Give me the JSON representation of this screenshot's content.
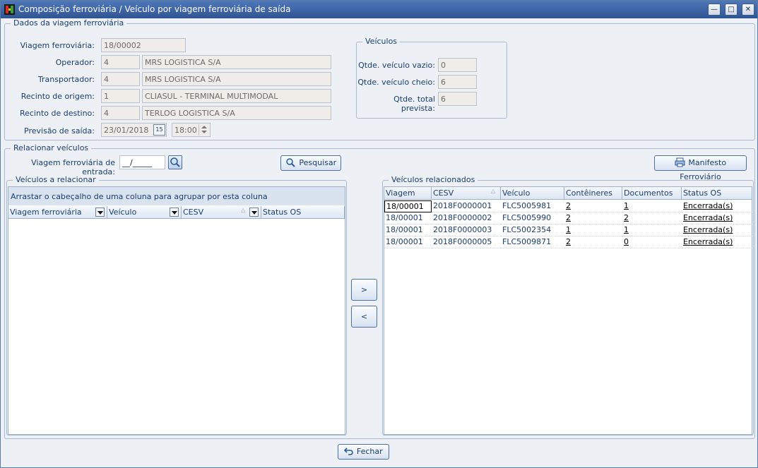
{
  "window": {
    "title": "Composição ferroviária / Veículo por viagem ferroviária de saída"
  },
  "dados": {
    "legend": "Dados da viagem ferroviária",
    "viagem_label": "Viagem ferroviária:",
    "viagem_value": "18/00002",
    "operador_label": "Operador:",
    "operador_code": "4",
    "operador_name": "MRS LOGISTICA S/A",
    "transportador_label": "Transportador:",
    "transportador_code": "4",
    "transportador_name": "MRS LOGISTICA S/A",
    "origem_label": "Recinto de origem:",
    "origem_code": "1",
    "origem_name": "CLIASUL - TERMINAL MULTIMODAL",
    "destino_label": "Recinto de destino:",
    "destino_code": "4",
    "destino_name": "TERLOG LOGISTICA S/A",
    "previsao_label": "Previsão de saída:",
    "previsao_date": "23/01/2018",
    "previsao_time": "18:00",
    "calendar_label": "15"
  },
  "veiculos": {
    "legend": "Veículos",
    "vazio_label": "Qtde. veículo vazio:",
    "vazio_value": "0",
    "cheio_label": "Qtde. veículo cheio:",
    "cheio_value": "6",
    "total_label": "Qtde. total prevista:",
    "total_value": "6"
  },
  "relacionar": {
    "legend": "Relacionar veículos",
    "entrada_label": "Viagem ferroviária de entrada:",
    "entrada_value": "__/_____",
    "pesquisar_label": "Pesquisar",
    "manifesto_label": "Manifesto Ferroviário"
  },
  "left_grid": {
    "legend": "Veículos a relacionar",
    "group_hint": "Arrastar o cabeçalho de uma coluna para agrupar por esta coluna",
    "columns": [
      "Viagem ferroviária",
      "Veículo",
      "CESV",
      "Status OS"
    ]
  },
  "right_grid": {
    "legend": "Veículos relacionados",
    "columns": [
      "Viagem",
      "CESV",
      "Veículo",
      "Contêineres",
      "Documentos",
      "Status OS"
    ],
    "rows": [
      {
        "viagem": "18/00001",
        "cesv": "2018F0000001",
        "veiculo": "FLC5005981",
        "conteineres": "2",
        "documentos": "1",
        "status": "Encerrada(s)"
      },
      {
        "viagem": "18/00001",
        "cesv": "2018F0000002",
        "veiculo": "FLC5005990",
        "conteineres": "2",
        "documentos": "2",
        "status": "Encerrada(s)"
      },
      {
        "viagem": "18/00001",
        "cesv": "2018F0000003",
        "veiculo": "FLC5002354",
        "conteineres": "1",
        "documentos": "1",
        "status": "Encerrada(s)"
      },
      {
        "viagem": "18/00001",
        "cesv": "2018F0000005",
        "veiculo": "FLC5009871",
        "conteineres": "2",
        "documentos": "0",
        "status": "Encerrada(s)"
      }
    ]
  },
  "transfer": {
    "add_label": ">",
    "remove_label": "<"
  },
  "footer": {
    "fechar_label": "Fechar"
  }
}
